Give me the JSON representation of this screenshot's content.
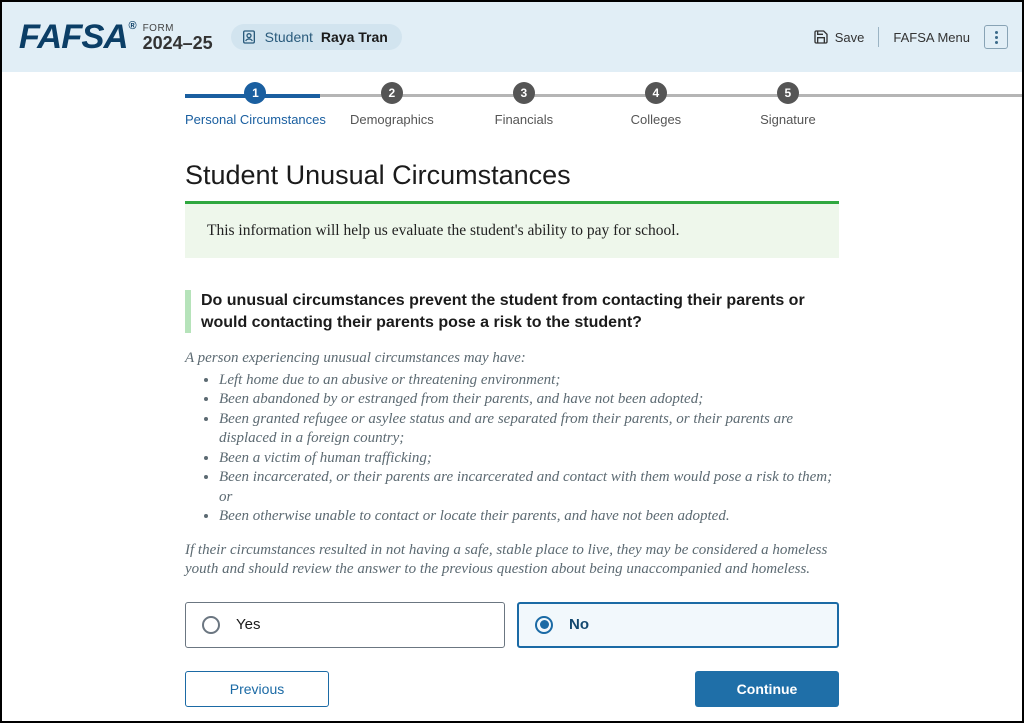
{
  "header": {
    "brand": "FAFSA",
    "reg": "®",
    "form_label": "FORM",
    "year": "2024–25",
    "student_role": "Student",
    "student_name": "Raya Tran",
    "save": "Save",
    "menu": "FAFSA Menu"
  },
  "stepper": {
    "steps": [
      {
        "num": "1",
        "label": "Personal Circumstances",
        "active": true
      },
      {
        "num": "2",
        "label": "Demographics",
        "active": false
      },
      {
        "num": "3",
        "label": "Financials",
        "active": false
      },
      {
        "num": "4",
        "label": "Colleges",
        "active": false
      },
      {
        "num": "5",
        "label": "Signature",
        "active": false
      }
    ]
  },
  "page": {
    "title": "Student Unusual Circumstances",
    "banner": "This information will help us evaluate the student's ability to pay for school.",
    "question": "Do unusual circumstances prevent the student from contacting their parents or would contacting their parents pose a risk to the student?",
    "help_intro": "A person experiencing unusual circumstances may have:",
    "help_items": [
      "Left home due to an abusive or threatening environment;",
      "Been abandoned by or estranged from their parents, and have not been adopted;",
      "Been granted refugee or asylee status and are separated from their parents, or their parents are displaced in a foreign country;",
      "Been a victim of human trafficking;",
      "Been incarcerated, or their parents are incarcerated and contact with them would pose a risk to them; or",
      "Been otherwise unable to contact or locate their parents, and have not been adopted."
    ],
    "help_tail": "If their circumstances resulted in not having a safe, stable place to live, they may be considered a homeless youth and should review the answer to the previous question about being unaccompanied and homeless.",
    "options": {
      "yes": "Yes",
      "no": "No",
      "selected": "no"
    },
    "nav": {
      "previous": "Previous",
      "continue": "Continue"
    }
  }
}
